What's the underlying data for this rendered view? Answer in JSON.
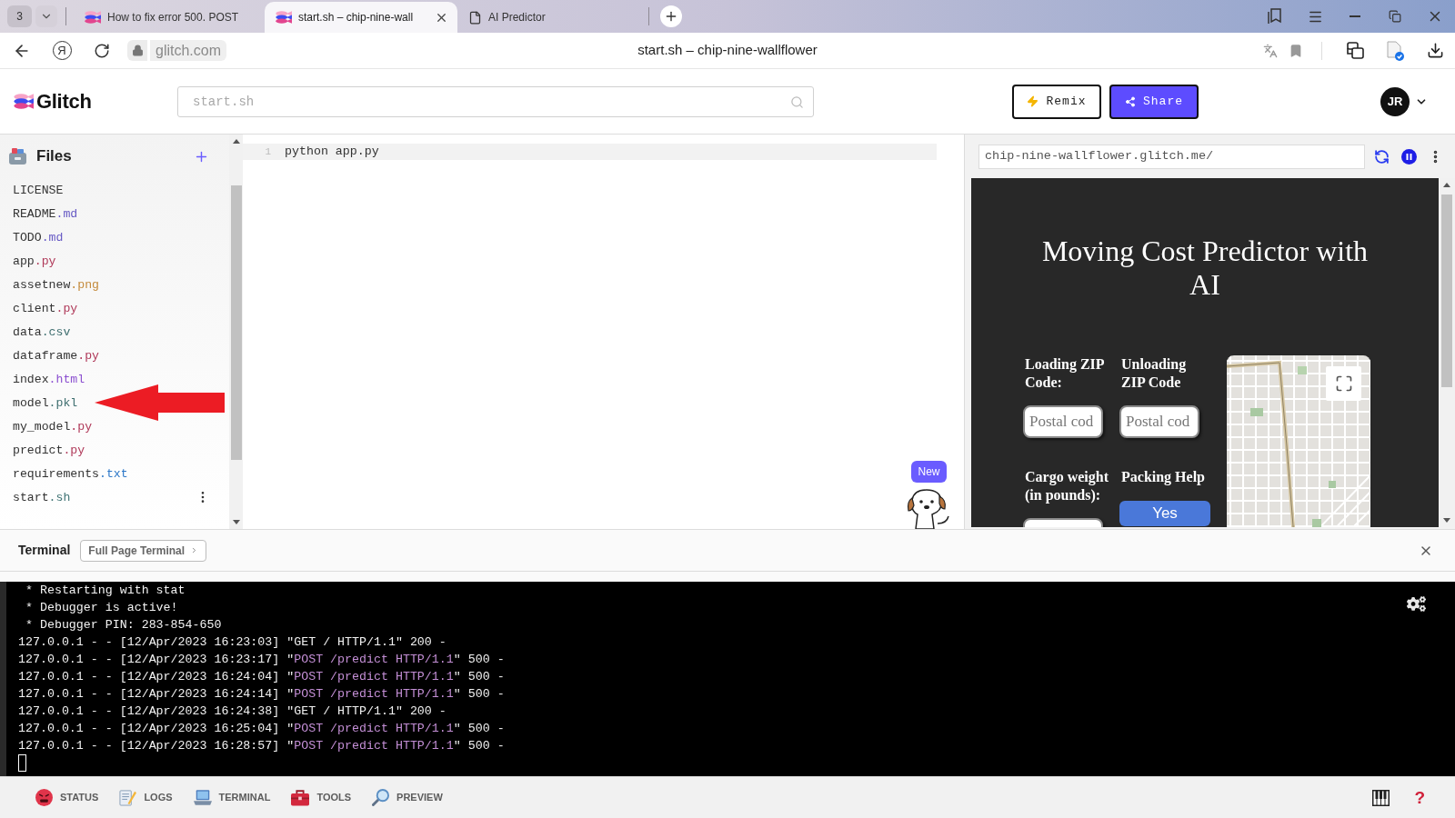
{
  "browser": {
    "tab_counter": "3",
    "tabs": [
      {
        "title": "How to fix error 500. POST",
        "kind": "glitch",
        "selected": false
      },
      {
        "title": "start.sh – chip-nine-wall",
        "kind": "glitch",
        "selected": true
      },
      {
        "title": "AI Predictor",
        "kind": "page",
        "selected": false
      }
    ],
    "home_button": "Я",
    "address": "glitch.com",
    "page_title": "start.sh – chip-nine-wallflower"
  },
  "header": {
    "logo": "Glitch",
    "search": {
      "placeholder": "start.sh"
    },
    "remix": "Remix",
    "share": "Share",
    "avatar": "JR"
  },
  "files": {
    "title": "Files",
    "items": [
      {
        "name": "LICENSE",
        "selected": false
      },
      {
        "name": "README",
        "ext": ".md",
        "color": "#6659c4",
        "selected": false
      },
      {
        "name": "TODO",
        "ext": ".md",
        "color": "#6659c4",
        "selected": false
      },
      {
        "name": "app",
        "ext": ".py",
        "color": "#b03a5a",
        "selected": false
      },
      {
        "name": "assetnew",
        "ext": ".png",
        "color": "#c48b3c",
        "selected": false
      },
      {
        "name": "client",
        "ext": ".py",
        "color": "#b03a5a",
        "selected": false
      },
      {
        "name": "data",
        "ext": ".csv",
        "color": "#3f6f70",
        "selected": false
      },
      {
        "name": "dataframe",
        "ext": ".py",
        "color": "#b03a5a",
        "selected": false
      },
      {
        "name": "index",
        "ext": ".html",
        "color": "#8b4fd0",
        "selected": false
      },
      {
        "name": "model",
        "ext": ".pkl",
        "color": "#3f6f70",
        "selected": false
      },
      {
        "name": "my_model",
        "ext": ".py",
        "color": "#b03a5a",
        "selected": false
      },
      {
        "name": "predict",
        "ext": ".py",
        "color": "#b03a5a",
        "selected": false
      },
      {
        "name": "requirements",
        "ext": ".txt",
        "color": "#2d78c8",
        "selected": false
      },
      {
        "name": "start",
        "ext": ".sh",
        "color": "#3f7374",
        "selected": true
      }
    ]
  },
  "editor": {
    "lines": [
      {
        "number": "1",
        "text": "python app.py",
        "active": true
      }
    ],
    "badge": "New"
  },
  "preview": {
    "url": "chip-nine-wallflower.glitch.me/",
    "app": {
      "title": "Moving Cost Predictor with AI",
      "fields": [
        {
          "label": "Loading ZIP Code:",
          "kind": "input",
          "placeholder": "Postal cod"
        },
        {
          "label": "Unloading ZIP Code",
          "kind": "input",
          "placeholder": "Postal cod"
        },
        {
          "label": "Cargo weight (in pounds):",
          "kind": "input"
        },
        {
          "label": "Packing Help",
          "kind": "button",
          "button": "Yes"
        }
      ]
    }
  },
  "terminal": {
    "title": "Terminal",
    "full_page_button": "Full Page Terminal",
    "lines": [
      {
        "segments": [
          {
            "text": " * Restarting with stat",
            "highlight": false
          }
        ]
      },
      {
        "segments": [
          {
            "text": " * Debugger is active!",
            "highlight": false
          }
        ]
      },
      {
        "segments": [
          {
            "text": " * Debugger PIN: 283-854-650",
            "highlight": false
          }
        ]
      },
      {
        "segments": [
          {
            "text": "127.0.0.1 - - [12/Apr/2023 16:23:03] \"GET / HTTP/1.1\" 200 -",
            "highlight": false
          }
        ]
      },
      {
        "segments": [
          {
            "text": "127.0.0.1 - - [12/Apr/2023 16:23:17] \"",
            "highlight": false
          },
          {
            "text": "POST /predict HTTP/1.1",
            "highlight": true
          },
          {
            "text": "\" 500 -",
            "highlight": false
          }
        ]
      },
      {
        "segments": [
          {
            "text": "127.0.0.1 - - [12/Apr/2023 16:24:04] \"",
            "highlight": false
          },
          {
            "text": "POST /predict HTTP/1.1",
            "highlight": true
          },
          {
            "text": "\" 500 -",
            "highlight": false
          }
        ]
      },
      {
        "segments": [
          {
            "text": "127.0.0.1 - - [12/Apr/2023 16:24:14] \"",
            "highlight": false
          },
          {
            "text": "POST /predict HTTP/1.1",
            "highlight": true
          },
          {
            "text": "\" 500 -",
            "highlight": false
          }
        ]
      },
      {
        "segments": [
          {
            "text": "127.0.0.1 - - [12/Apr/2023 16:24:38] \"GET / HTTP/1.1\" 200 -",
            "highlight": false
          }
        ]
      },
      {
        "segments": [
          {
            "text": "127.0.0.1 - - [12/Apr/2023 16:25:04] \"",
            "highlight": false
          },
          {
            "text": "POST /predict HTTP/1.1",
            "highlight": true
          },
          {
            "text": "\" 500 -",
            "highlight": false
          }
        ]
      },
      {
        "segments": [
          {
            "text": "127.0.0.1 - - [12/Apr/2023 16:28:57] \"",
            "highlight": false
          },
          {
            "text": "POST /predict HTTP/1.1",
            "highlight": true
          },
          {
            "text": "\" 500 -",
            "highlight": false
          }
        ]
      }
    ]
  },
  "status_bar": {
    "items": [
      {
        "label": "STATUS",
        "kind": "status"
      },
      {
        "label": "LOGS",
        "kind": "logs"
      },
      {
        "label": "TERMINAL",
        "kind": "terminal"
      },
      {
        "label": "TOOLS",
        "kind": "tools"
      },
      {
        "label": "PREVIEW",
        "kind": "preview"
      }
    ],
    "help": "?"
  }
}
